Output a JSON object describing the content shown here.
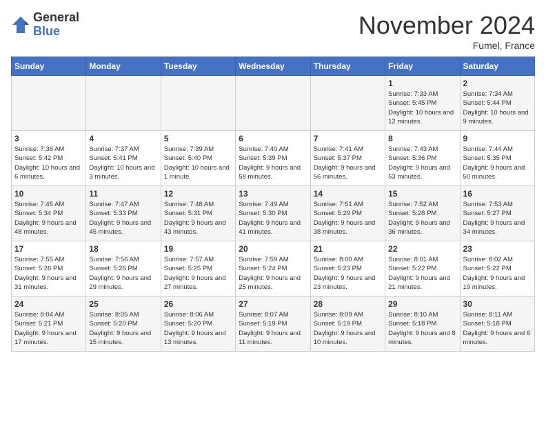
{
  "header": {
    "logo_general": "General",
    "logo_blue": "Blue",
    "month_title": "November 2024",
    "subtitle": "Fumel, France"
  },
  "days_of_week": [
    "Sunday",
    "Monday",
    "Tuesday",
    "Wednesday",
    "Thursday",
    "Friday",
    "Saturday"
  ],
  "weeks": [
    [
      {
        "day": "",
        "info": ""
      },
      {
        "day": "",
        "info": ""
      },
      {
        "day": "",
        "info": ""
      },
      {
        "day": "",
        "info": ""
      },
      {
        "day": "",
        "info": ""
      },
      {
        "day": "1",
        "info": "Sunrise: 7:33 AM\nSunset: 5:45 PM\nDaylight: 10 hours and 12 minutes."
      },
      {
        "day": "2",
        "info": "Sunrise: 7:34 AM\nSunset: 5:44 PM\nDaylight: 10 hours and 9 minutes."
      }
    ],
    [
      {
        "day": "3",
        "info": "Sunrise: 7:36 AM\nSunset: 5:42 PM\nDaylight: 10 hours and 6 minutes."
      },
      {
        "day": "4",
        "info": "Sunrise: 7:37 AM\nSunset: 5:41 PM\nDaylight: 10 hours and 3 minutes."
      },
      {
        "day": "5",
        "info": "Sunrise: 7:39 AM\nSunset: 5:40 PM\nDaylight: 10 hours and 1 minute."
      },
      {
        "day": "6",
        "info": "Sunrise: 7:40 AM\nSunset: 5:39 PM\nDaylight: 9 hours and 58 minutes."
      },
      {
        "day": "7",
        "info": "Sunrise: 7:41 AM\nSunset: 5:37 PM\nDaylight: 9 hours and 56 minutes."
      },
      {
        "day": "8",
        "info": "Sunrise: 7:43 AM\nSunset: 5:36 PM\nDaylight: 9 hours and 53 minutes."
      },
      {
        "day": "9",
        "info": "Sunrise: 7:44 AM\nSunset: 5:35 PM\nDaylight: 9 hours and 50 minutes."
      }
    ],
    [
      {
        "day": "10",
        "info": "Sunrise: 7:45 AM\nSunset: 5:34 PM\nDaylight: 9 hours and 48 minutes."
      },
      {
        "day": "11",
        "info": "Sunrise: 7:47 AM\nSunset: 5:33 PM\nDaylight: 9 hours and 45 minutes."
      },
      {
        "day": "12",
        "info": "Sunrise: 7:48 AM\nSunset: 5:31 PM\nDaylight: 9 hours and 43 minutes."
      },
      {
        "day": "13",
        "info": "Sunrise: 7:49 AM\nSunset: 5:30 PM\nDaylight: 9 hours and 41 minutes."
      },
      {
        "day": "14",
        "info": "Sunrise: 7:51 AM\nSunset: 5:29 PM\nDaylight: 9 hours and 38 minutes."
      },
      {
        "day": "15",
        "info": "Sunrise: 7:52 AM\nSunset: 5:28 PM\nDaylight: 9 hours and 36 minutes."
      },
      {
        "day": "16",
        "info": "Sunrise: 7:53 AM\nSunset: 5:27 PM\nDaylight: 9 hours and 34 minutes."
      }
    ],
    [
      {
        "day": "17",
        "info": "Sunrise: 7:55 AM\nSunset: 5:26 PM\nDaylight: 9 hours and 31 minutes."
      },
      {
        "day": "18",
        "info": "Sunrise: 7:56 AM\nSunset: 5:26 PM\nDaylight: 9 hours and 29 minutes."
      },
      {
        "day": "19",
        "info": "Sunrise: 7:57 AM\nSunset: 5:25 PM\nDaylight: 9 hours and 27 minutes."
      },
      {
        "day": "20",
        "info": "Sunrise: 7:59 AM\nSunset: 5:24 PM\nDaylight: 9 hours and 25 minutes."
      },
      {
        "day": "21",
        "info": "Sunrise: 8:00 AM\nSunset: 5:23 PM\nDaylight: 9 hours and 23 minutes."
      },
      {
        "day": "22",
        "info": "Sunrise: 8:01 AM\nSunset: 5:22 PM\nDaylight: 9 hours and 21 minutes."
      },
      {
        "day": "23",
        "info": "Sunrise: 8:02 AM\nSunset: 5:22 PM\nDaylight: 9 hours and 19 minutes."
      }
    ],
    [
      {
        "day": "24",
        "info": "Sunrise: 8:04 AM\nSunset: 5:21 PM\nDaylight: 9 hours and 17 minutes."
      },
      {
        "day": "25",
        "info": "Sunrise: 8:05 AM\nSunset: 5:20 PM\nDaylight: 9 hours and 15 minutes."
      },
      {
        "day": "26",
        "info": "Sunrise: 8:06 AM\nSunset: 5:20 PM\nDaylight: 9 hours and 13 minutes."
      },
      {
        "day": "27",
        "info": "Sunrise: 8:07 AM\nSunset: 5:19 PM\nDaylight: 9 hours and 11 minutes."
      },
      {
        "day": "28",
        "info": "Sunrise: 8:09 AM\nSunset: 5:19 PM\nDaylight: 9 hours and 10 minutes."
      },
      {
        "day": "29",
        "info": "Sunrise: 8:10 AM\nSunset: 5:18 PM\nDaylight: 9 hours and 8 minutes."
      },
      {
        "day": "30",
        "info": "Sunrise: 8:11 AM\nSunset: 5:18 PM\nDaylight: 9 hours and 6 minutes."
      }
    ]
  ]
}
